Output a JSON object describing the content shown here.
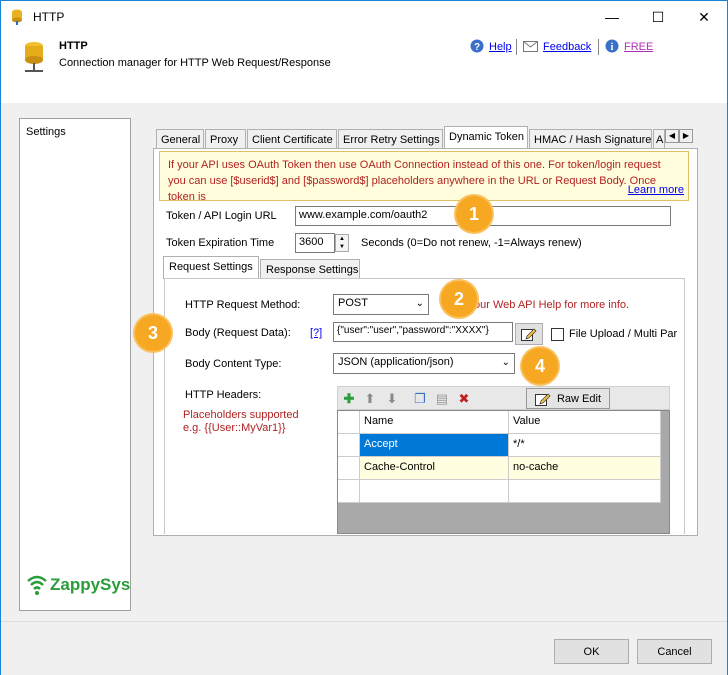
{
  "window": {
    "title": "HTTP",
    "minimize": "—",
    "maximize": "☐",
    "close": "✕"
  },
  "header": {
    "title": "HTTP",
    "subtitle": "Connection manager for HTTP Web Request/Response",
    "help_label": "Help",
    "feedback_label": "Feedback",
    "free_label": "FREE"
  },
  "sidebar": {
    "items": [
      {
        "label": "Settings"
      }
    ],
    "brand": "ZappySys"
  },
  "tabs": [
    "General",
    "Proxy",
    "Client Certificate",
    "Error Retry Settings",
    "Dynamic Token",
    "HMAC / Hash Signature",
    "A"
  ],
  "active_tab": "Dynamic Token",
  "warning": {
    "text": "If your API uses OAuth Token then use OAuth Connection instead of this one. For token/login request you can use [$userid$] and [$password$] placeholders anywhere in the URL or Request Body. Once token is",
    "link": "Learn more"
  },
  "token": {
    "url_label": "Token / API Login URL",
    "url_value": "www.example.com/oauth2",
    "expiration_label": "Token Expiration Time",
    "expiration_value": "3600",
    "expiration_hint": "Seconds (0=Do not renew, -1=Always renew)"
  },
  "subtabs": [
    "Request Settings",
    "Response Settings"
  ],
  "request": {
    "method_label": "HTTP Request Method:",
    "method_value": "POST",
    "method_hint": "our Web API Help for more info.",
    "body_label": "Body (Request Data):",
    "body_help": "[?]",
    "body_value": "{\"user\":\"user\",\"password\":\"XXXX\"}",
    "file_upload_label": "File Upload / Multi Par",
    "content_type_label": "Body Content Type:",
    "content_type_value": "JSON (application/json)",
    "headers_label": "HTTP Headers:",
    "placeholders_note_1": "Placeholders supported",
    "placeholders_note_2": "e.g. {{User::MyVar1}}",
    "raw_edit_label": "Raw Edit"
  },
  "headers_grid": {
    "columns": [
      "Name",
      "Value"
    ],
    "rows": [
      {
        "name": "Accept",
        "value": "*/*"
      },
      {
        "name": "Cache-Control",
        "value": "no-cache"
      }
    ]
  },
  "badges": [
    "1",
    "2",
    "3",
    "4"
  ],
  "footer": {
    "ok_label": "OK",
    "cancel_label": "Cancel"
  }
}
